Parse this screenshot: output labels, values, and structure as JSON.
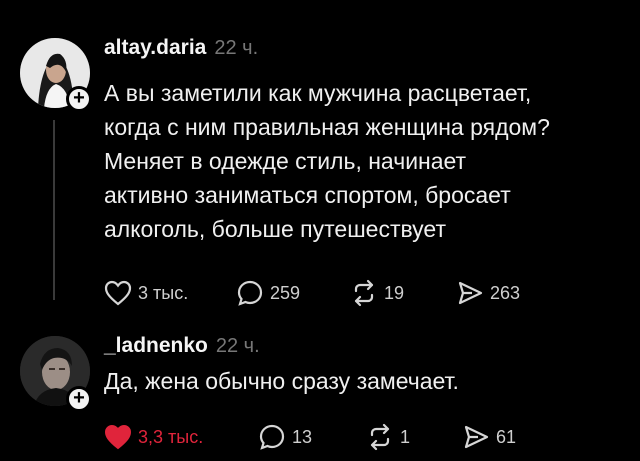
{
  "posts": [
    {
      "username": "altay.daria",
      "time": "22 ч.",
      "text": "А вы заметили как мужчина расцветает,\nкогда с ним правильная женщина рядом?\nМеняет в одежде стиль, начинает\nактивно заниматься спортом, бросает\nалкоголь, больше путешествует",
      "likes": "3 тыс.",
      "comments": "259",
      "reposts": "19",
      "shares": "263"
    },
    {
      "username": "_ladnenko",
      "time": "22 ч.",
      "text": "Да, жена обычно сразу замечает.",
      "likes": "3,3 тыс.",
      "comments": "13",
      "reposts": "1",
      "shares": "61"
    }
  ],
  "icons": {
    "like": "heart-icon",
    "comment": "speech-bubble-icon",
    "repost": "repost-icon",
    "share": "send-icon",
    "follow": "plus-icon"
  },
  "colors": {
    "background": "#000000",
    "liked": "#e0243b",
    "muted": "#777777"
  }
}
